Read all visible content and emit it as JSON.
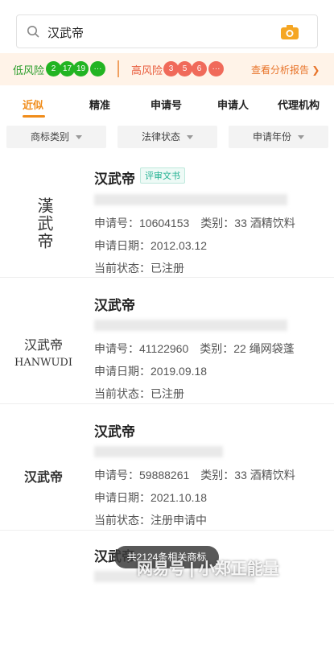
{
  "search": {
    "query": "汉武帝"
  },
  "risk": {
    "low_label": "低风险",
    "low_counts": [
      "2",
      "17",
      "19",
      "···"
    ],
    "high_label": "高风险",
    "high_counts": [
      "3",
      "5",
      "6",
      "···"
    ],
    "report_link": "查看分析报告 ❯"
  },
  "tabs": [
    "近似",
    "精准",
    "申请号",
    "申请人",
    "代理机构"
  ],
  "filters": [
    "商标类别",
    "法律状态",
    "申请年份"
  ],
  "labels": {
    "app_no": "申请号：",
    "category": "类别：",
    "app_date": "申请日期：",
    "status": "当前状态："
  },
  "results": [
    {
      "title": "汉武帝",
      "badge": "评审文书",
      "mark": "漢武帝",
      "mark_sub": "",
      "app_no": "10604153",
      "category": "33 酒精饮料",
      "app_date": "2012.03.12",
      "status": "已注册"
    },
    {
      "title": "汉武帝",
      "badge": "",
      "mark": "汉武帝",
      "mark_sub": "HANWUDI",
      "app_no": "41122960",
      "category": "22 绳网袋蓬",
      "app_date": "2019.09.18",
      "status": "已注册"
    },
    {
      "title": "汉武帝",
      "badge": "",
      "mark": "汉武帝",
      "mark_sub": "",
      "app_no": "59888261",
      "category": "33 酒精饮料",
      "app_date": "2021.10.18",
      "status": "注册申请中"
    },
    {
      "title": "汉武帝",
      "badge": "",
      "mark": "",
      "mark_sub": "",
      "app_no": "",
      "category": "",
      "app_date": "",
      "status": ""
    }
  ],
  "toast": "共2124条相关商标",
  "watermark": "网易号 | 小郑正能量",
  "colors": {
    "accent": "#f08c1a",
    "low": "#22b422",
    "high": "#f06a5a"
  }
}
